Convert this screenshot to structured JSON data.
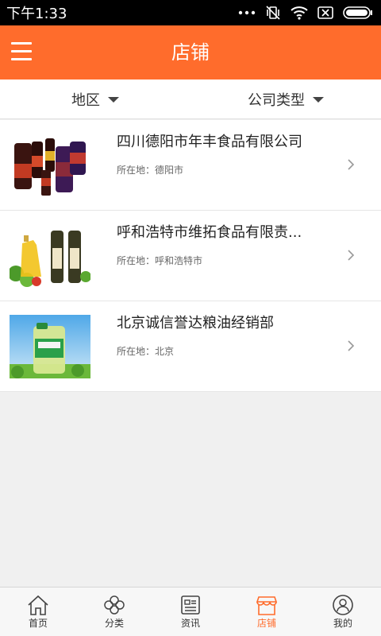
{
  "status": {
    "time": "下午1:33"
  },
  "header": {
    "title": "店铺"
  },
  "filters": [
    {
      "label": "地区"
    },
    {
      "label": "公司类型"
    }
  ],
  "shops": [
    {
      "name": "四川德阳市年丰食品有限公司",
      "location": "所在地：德阳市",
      "thumb": "soy-sauce-bottles"
    },
    {
      "name": "呼和浩特市维拓食品有限责...",
      "location": "所在地：呼和浩特市",
      "thumb": "olive-oil-bottles"
    },
    {
      "name": "北京诚信誉达粮油经销部",
      "location": "所在地：北京",
      "thumb": "cooking-oil-jug"
    }
  ],
  "tabs": [
    {
      "label": "首页",
      "icon": "home-icon"
    },
    {
      "label": "分类",
      "icon": "category-icon"
    },
    {
      "label": "资讯",
      "icon": "news-icon"
    },
    {
      "label": "店铺",
      "icon": "store-icon",
      "active": true
    },
    {
      "label": "我的",
      "icon": "profile-icon"
    }
  ],
  "colors": {
    "accent": "#ff6c2c",
    "status_bar": "#000000",
    "background": "#f0f0f0"
  }
}
